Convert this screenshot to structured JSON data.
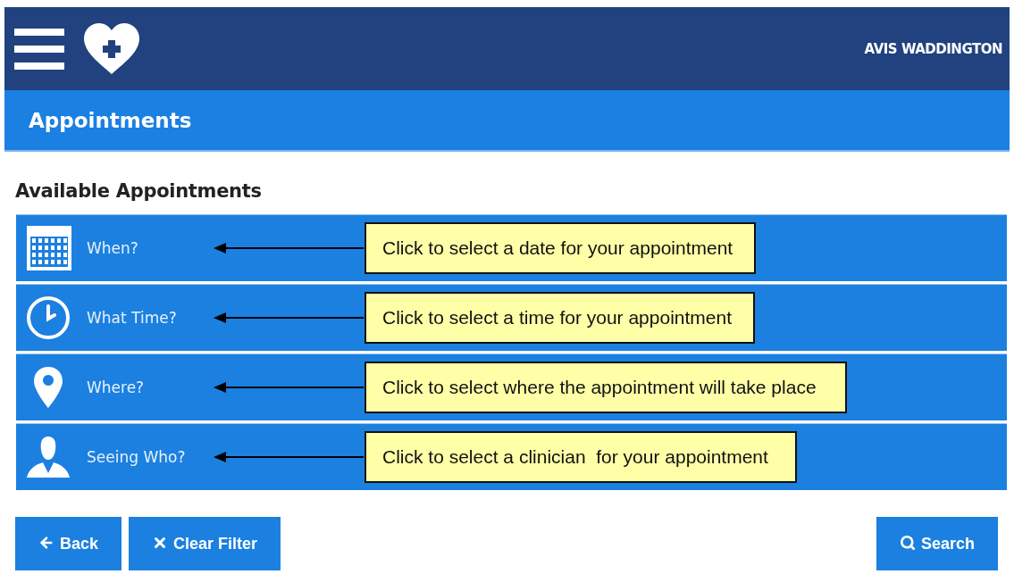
{
  "header": {
    "user_name": "AVIS WADDINGTON"
  },
  "page_bar": {
    "title": "Appointments"
  },
  "section_title": "Available Appointments",
  "filters": [
    {
      "kind": "date",
      "label": "When?",
      "callout": "Click to select a date for your appointment"
    },
    {
      "kind": "time",
      "label": "What Time?",
      "callout": "Click to select a time for your appointment"
    },
    {
      "kind": "place",
      "label": "Where?",
      "callout": "Click to select where the appointment will take place"
    },
    {
      "kind": "person",
      "label": "Seeing Who?",
      "callout": "Click to select a clinician  for your appointment"
    }
  ],
  "buttons": [
    {
      "kind": "back",
      "label": "Back"
    },
    {
      "kind": "clear",
      "label": "Clear Filter"
    },
    {
      "kind": "search",
      "label": "Search"
    }
  ]
}
